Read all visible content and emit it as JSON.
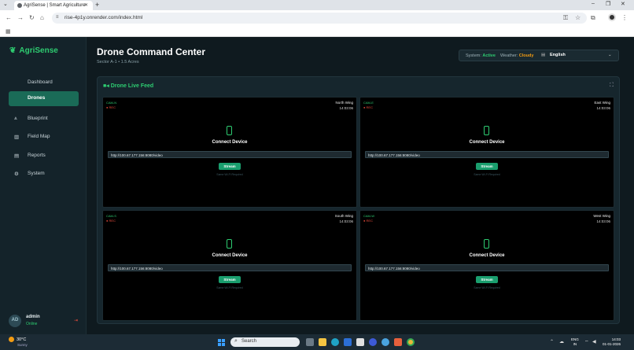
{
  "browser": {
    "tab_title": "AgriSense | Smart Agriculture",
    "url": "rise-4p1y.onrender.com/index.html"
  },
  "app": {
    "brand": "AgriSense"
  },
  "sidebar": {
    "items": [
      {
        "label": "Dashboard",
        "icon": "none",
        "active": false
      },
      {
        "label": "Drones",
        "icon": "none",
        "active": true
      },
      {
        "label": "Blueprint",
        "icon": "blueprint-icon",
        "active": false
      },
      {
        "label": "Field Map",
        "icon": "map-icon",
        "active": false
      },
      {
        "label": "Reports",
        "icon": "reports-icon",
        "active": false
      },
      {
        "label": "System",
        "icon": "gear-icon",
        "active": false
      }
    ],
    "user": {
      "initials": "AD",
      "name": "admin",
      "status": "Online"
    }
  },
  "header": {
    "title": "Drone Command Center",
    "subtitle": "Sector A-1 • 1.5 Acres",
    "system_label": "System:",
    "system_value": "Active",
    "weather_label": "Weather:",
    "weather_value": "Cloudy",
    "language": "English",
    "colors": {
      "active": "#2ecc71",
      "weather": "#f39c12"
    }
  },
  "feed": {
    "title": "Drone Live Feed",
    "cameras": [
      {
        "id": "CAM-N",
        "rec": "● REC",
        "wing": "North Wing",
        "time": "14:03:06",
        "connect": "Connect Device",
        "url": "http://100.67.177.156:8080/video",
        "button": "Stream",
        "note": "Same Wi-Fi Required"
      },
      {
        "id": "CAM-E",
        "rec": "● REC",
        "wing": "East Wing",
        "time": "14:03:06",
        "connect": "Connect Device",
        "url": "http://100.67.177.156:8080/video",
        "button": "Stream",
        "note": "Same Wi-Fi Required"
      },
      {
        "id": "CAM-S",
        "rec": "● REC",
        "wing": "South Wing",
        "time": "14:03:06",
        "connect": "Connect Device",
        "url": "http://100.67.177.156:8080/video",
        "button": "Stream",
        "note": "Same Wi-Fi Required"
      },
      {
        "id": "CAM-W",
        "rec": "● REC",
        "wing": "West Wing",
        "time": "14:03:06",
        "connect": "Connect Device",
        "url": "http://100.67.177.156:8080/video",
        "button": "Stream",
        "note": "Same Wi-Fi Required"
      }
    ]
  },
  "taskbar": {
    "temp": "30°C",
    "condition": "Sunny",
    "search": "Search",
    "lang_top": "ENG",
    "lang_bottom": "IN",
    "time": "14:03",
    "date": "01-01-2026"
  }
}
